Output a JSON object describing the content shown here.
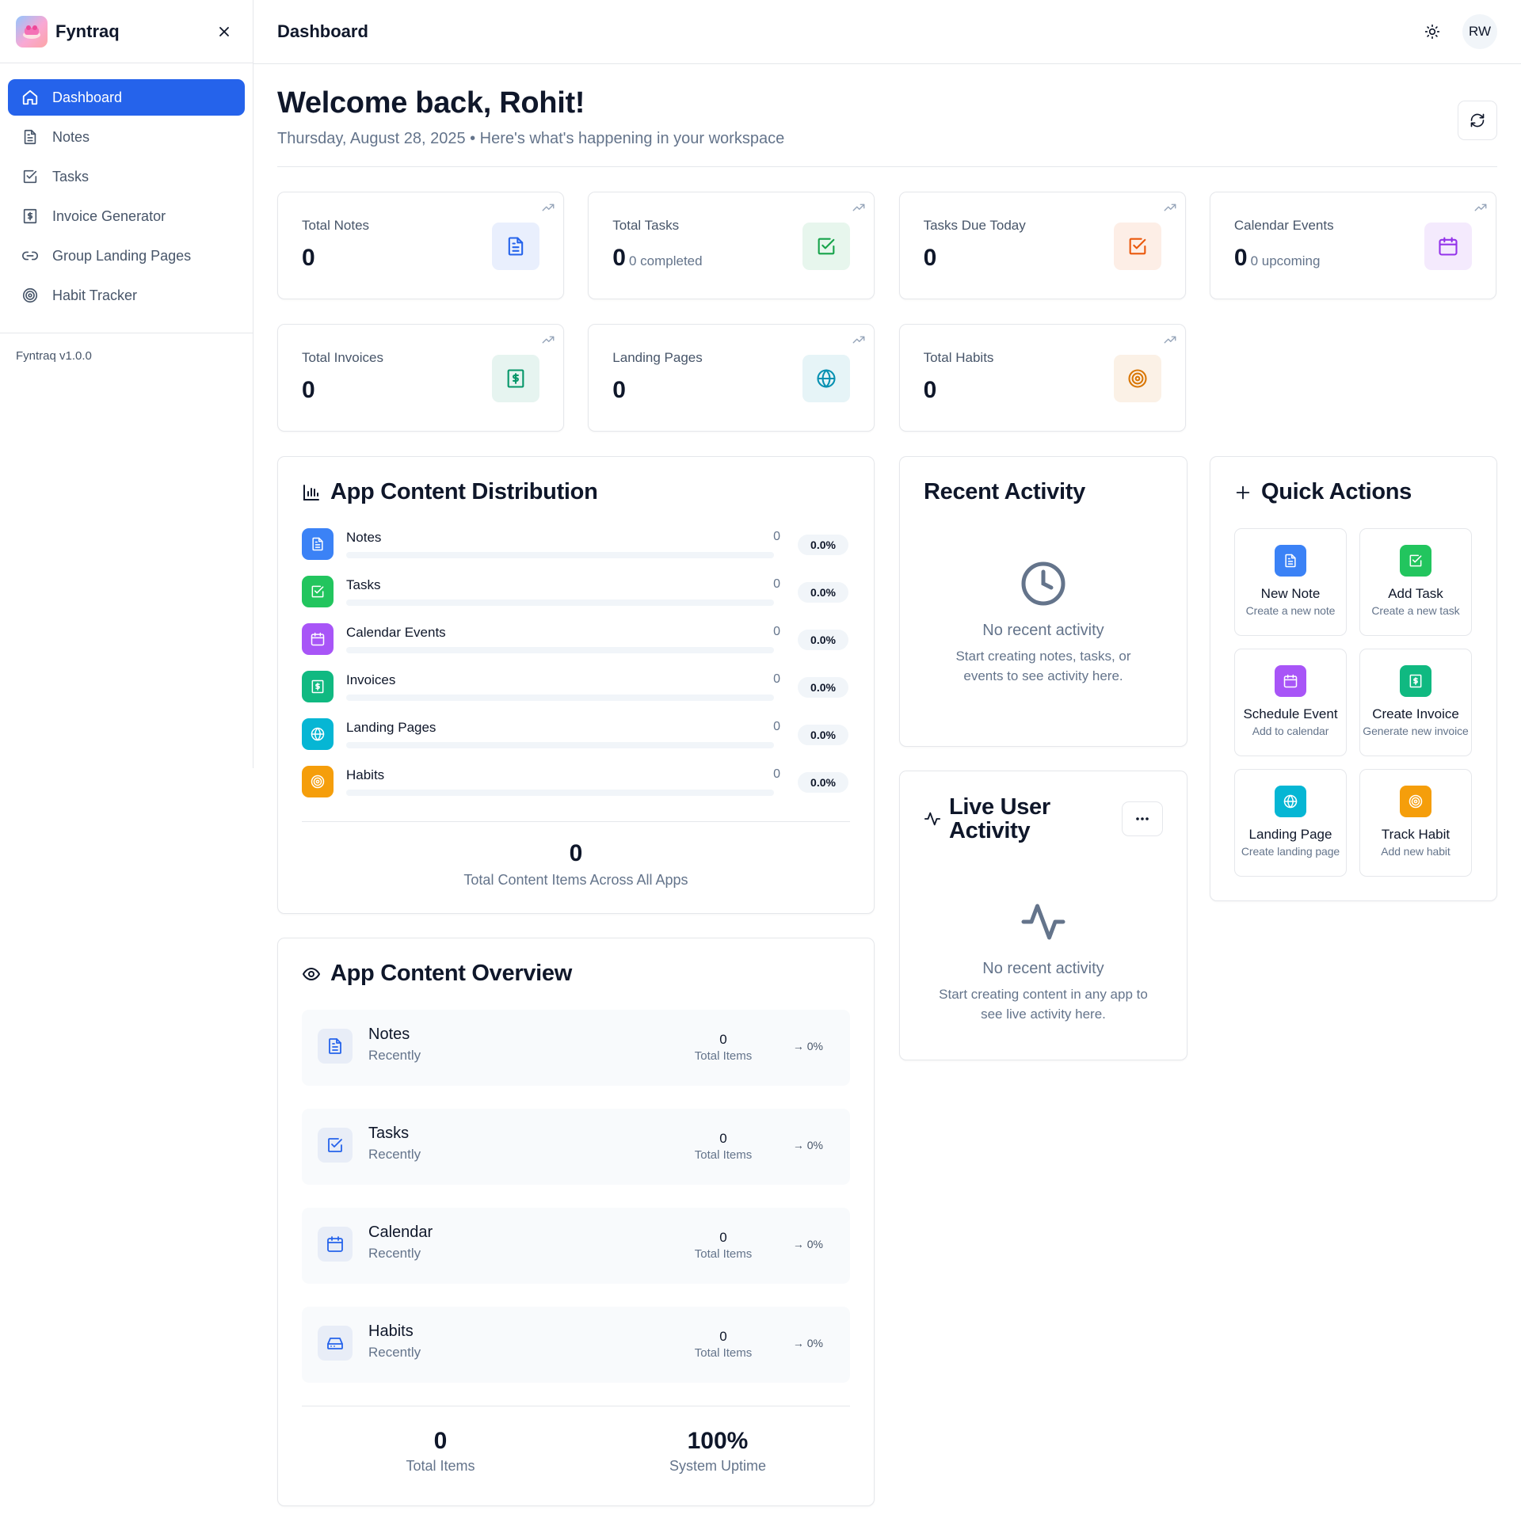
{
  "sidebar": {
    "brand": "Fyntraq",
    "items": [
      {
        "label": "Dashboard"
      },
      {
        "label": "Notes"
      },
      {
        "label": "Tasks"
      },
      {
        "label": "Invoice Generator"
      },
      {
        "label": "Group Landing Pages"
      },
      {
        "label": "Habit Tracker"
      }
    ],
    "version": "Fyntraq v1.0.0"
  },
  "header": {
    "title": "Dashboard",
    "avatar": "RW"
  },
  "welcome": {
    "title": "Welcome back, Rohit!",
    "subtitle": "Thursday, August 28, 2025 • Here's what's happening in your workspace"
  },
  "stats": [
    {
      "label": "Total Notes",
      "value": "0",
      "sub": "",
      "icon": "note-icon",
      "color": "#2563eb"
    },
    {
      "label": "Total Tasks",
      "value": "0",
      "sub": "0 completed",
      "icon": "check-square-icon",
      "color": "#16a34a"
    },
    {
      "label": "Tasks Due Today",
      "value": "0",
      "sub": "",
      "icon": "check-square-icon",
      "color": "#ea580c"
    },
    {
      "label": "Calendar Events",
      "value": "0",
      "sub": "0 upcoming",
      "icon": "calendar-icon",
      "color": "#9333ea"
    },
    {
      "label": "Total Invoices",
      "value": "0",
      "sub": "",
      "icon": "invoice-icon",
      "color": "#059669"
    },
    {
      "label": "Landing Pages",
      "value": "0",
      "sub": "",
      "icon": "globe-icon",
      "color": "#0891b2"
    },
    {
      "label": "Total Habits",
      "value": "0",
      "sub": "",
      "icon": "target-icon",
      "color": "#d97706"
    }
  ],
  "distribution": {
    "title": "App Content Distribution",
    "rows": [
      {
        "name": "Notes",
        "count": "0",
        "pct": "0.0%",
        "color": "#3b82f6"
      },
      {
        "name": "Tasks",
        "count": "0",
        "pct": "0.0%",
        "color": "#22c55e"
      },
      {
        "name": "Calendar Events",
        "count": "0",
        "pct": "0.0%",
        "color": "#a855f7"
      },
      {
        "name": "Invoices",
        "count": "0",
        "pct": "0.0%",
        "color": "#10b981"
      },
      {
        "name": "Landing Pages",
        "count": "0",
        "pct": "0.0%",
        "color": "#06b6d4"
      },
      {
        "name": "Habits",
        "count": "0",
        "pct": "0.0%",
        "color": "#f59e0b"
      }
    ],
    "total": "0",
    "total_label": "Total Content Items Across All Apps"
  },
  "recent": {
    "title": "Recent Activity",
    "empty_title": "No recent activity",
    "empty_desc_1": "Start creating notes, tasks, or",
    "empty_desc_2": "events to see activity here."
  },
  "live": {
    "title_1": "Live User",
    "title_2": "Activity",
    "empty_title": "No recent activity",
    "empty_desc_1": "Start creating content in any app to",
    "empty_desc_2": "see live activity here."
  },
  "quick": {
    "title": "Quick Actions",
    "items": [
      {
        "title": "New Note",
        "desc": "Create a new note",
        "color": "#3b82f6"
      },
      {
        "title": "Add Task",
        "desc": "Create a new task",
        "color": "#22c55e"
      },
      {
        "title": "Schedule Event",
        "desc": "Add to calendar",
        "color": "#a855f7"
      },
      {
        "title": "Create Invoice",
        "desc": "Generate new invoice",
        "color": "#10b981"
      },
      {
        "title": "Landing Page",
        "desc": "Create landing page",
        "color": "#06b6d4"
      },
      {
        "title": "Track Habit",
        "desc": "Add new habit",
        "color": "#f59e0b"
      }
    ]
  },
  "overview": {
    "title": "App Content Overview",
    "rows": [
      {
        "name": "Notes",
        "sub": "Recently",
        "value": "0",
        "label": "Total Items",
        "change": "→ 0%"
      },
      {
        "name": "Tasks",
        "sub": "Recently",
        "value": "0",
        "label": "Total Items",
        "change": "→ 0%"
      },
      {
        "name": "Calendar",
        "sub": "Recently",
        "value": "0",
        "label": "Total Items",
        "change": "→ 0%"
      },
      {
        "name": "Habits",
        "sub": "Recently",
        "value": "0",
        "label": "Total Items",
        "change": "→ 0%"
      }
    ],
    "total_items": "0",
    "total_items_label": "Total Items",
    "uptime": "100%",
    "uptime_label": "System Uptime"
  }
}
